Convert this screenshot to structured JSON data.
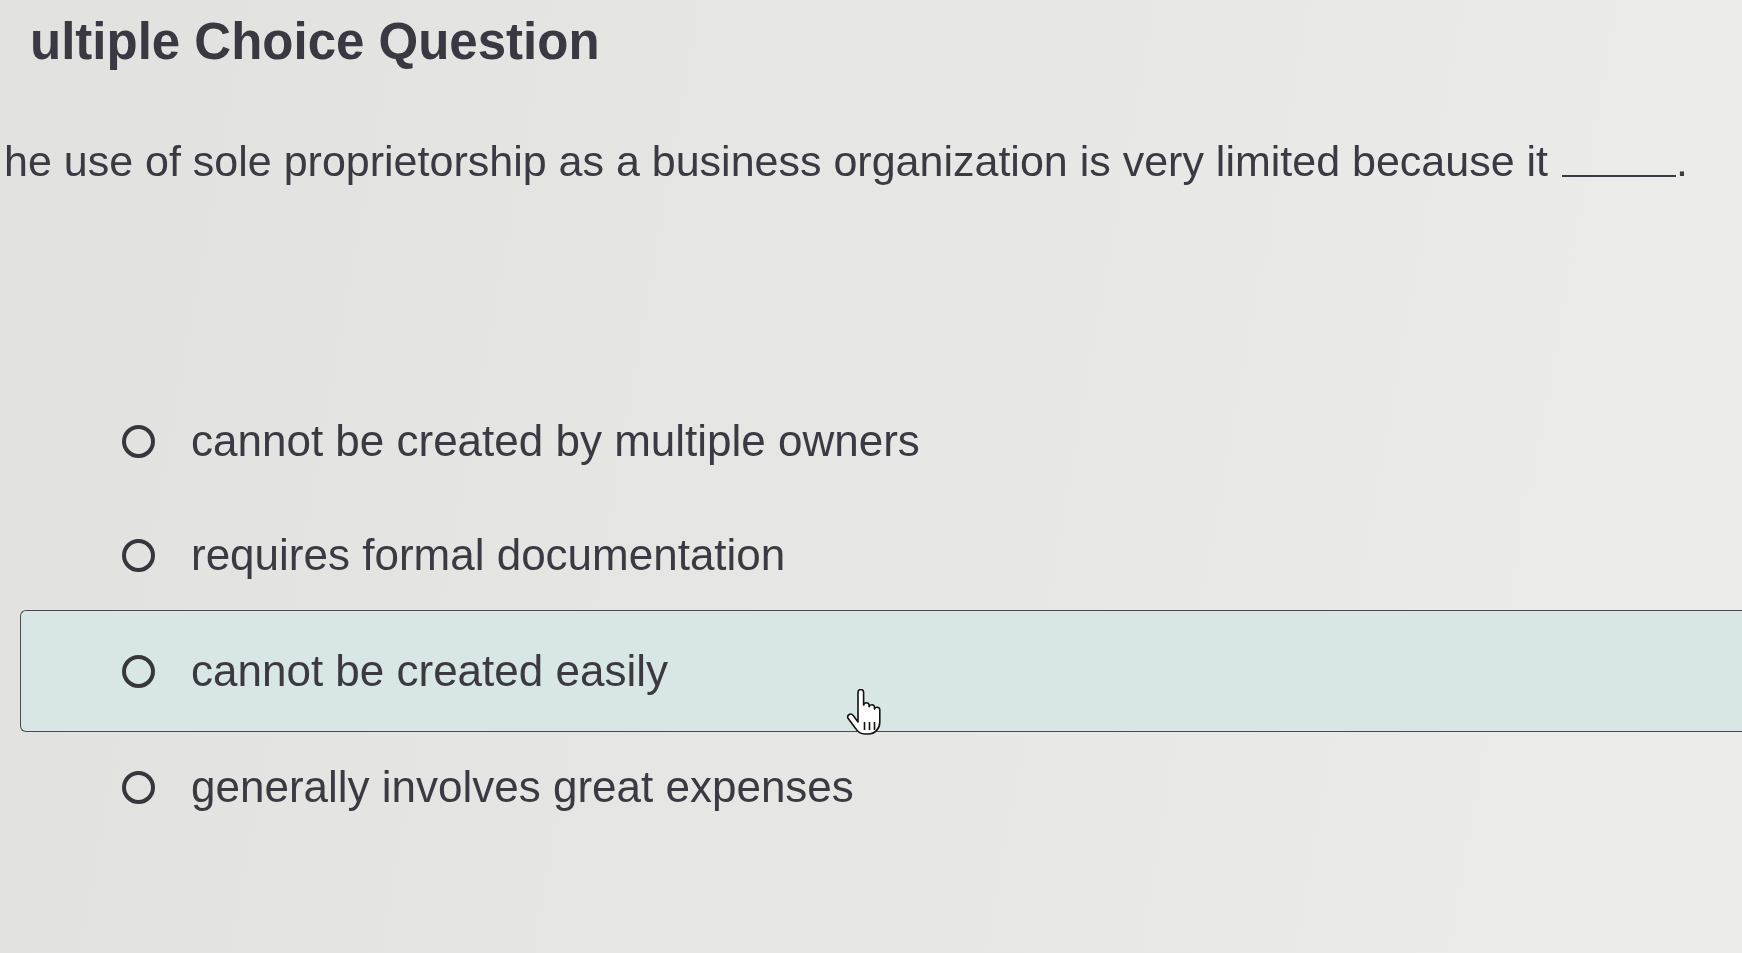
{
  "heading": "ultiple Choice Question",
  "question": {
    "text": "he use of sole proprietorship as a business organization is very limited because it",
    "after_blank": "."
  },
  "options": [
    {
      "label": "cannot be created by multiple owners",
      "selected": false,
      "hovered": false
    },
    {
      "label": "requires formal documentation",
      "selected": false,
      "hovered": false
    },
    {
      "label": "cannot be created easily",
      "selected": false,
      "hovered": true
    },
    {
      "label": "generally involves great expenses",
      "selected": false,
      "hovered": false
    }
  ]
}
